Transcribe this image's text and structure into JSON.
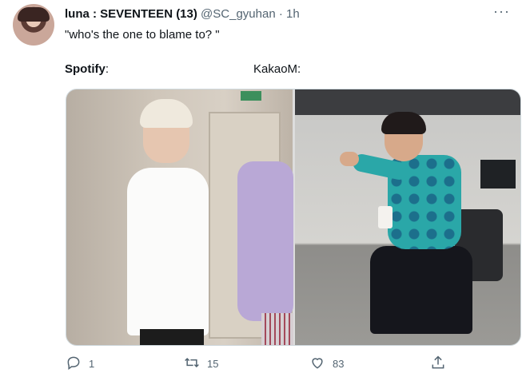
{
  "tweet": {
    "display_name": "luna : SEVENTEEN (13)",
    "handle": "@SC_gyuhan",
    "separator": "·",
    "time": "1h",
    "more": "···",
    "text": "\"who's the one to blame to? \""
  },
  "labels": {
    "left": "Spotify",
    "left_suffix": ":",
    "right": "KakaoM:"
  },
  "actions": {
    "replies": "1",
    "retweets": "15",
    "likes": "83"
  },
  "icons": [
    "reply-icon",
    "retweet-icon",
    "like-icon",
    "share-icon",
    "more-icon"
  ]
}
